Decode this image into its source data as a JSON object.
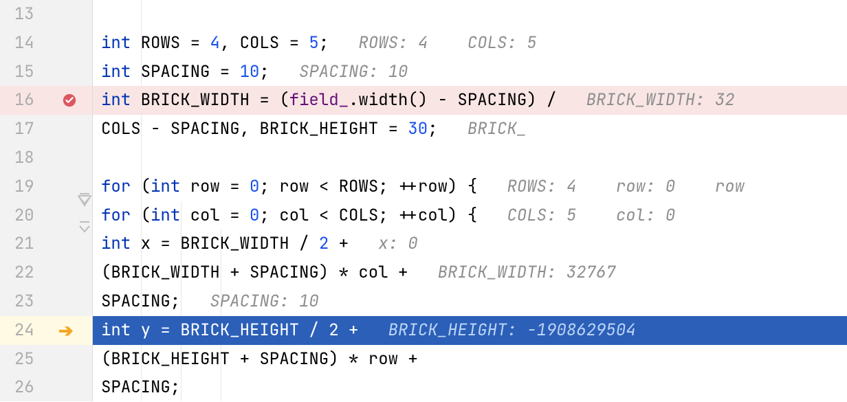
{
  "lines": {
    "l13": "13",
    "l14": "14",
    "l15": "15",
    "l16": "16",
    "l17": "17",
    "l18": "18",
    "l19": "19",
    "l20": "20",
    "l21": "21",
    "l22": "22",
    "l23": "23",
    "l24": "24",
    "l25": "25",
    "l26": "26"
  },
  "code": {
    "kw_int": "int",
    "kw_for": "for",
    "l14_a": " ROWS = ",
    "l14_n1": "4",
    "l14_b": ", COLS = ",
    "l14_n2": "5",
    "l14_c": ";",
    "l14_in": "   ROWS: 4    COLS: 5",
    "l15_a": " SPACING = ",
    "l15_n1": "10",
    "l15_b": ";",
    "l15_in": "   SPACING: 10",
    "l16_a": " BRICK_WIDTH = (",
    "l16_f": "field_",
    "l16_b": ".width() - SPACING) /",
    "l16_in": "   BRICK_WIDTH: 32",
    "l17_a": "COLS - SPACING, BRICK_HEIGHT = ",
    "l17_n1": "30",
    "l17_b": ";",
    "l17_in": "   BRICK_",
    "l19_a": " (",
    "l19_b": " row = ",
    "l19_n1": "0",
    "l19_c": "; row < ROWS; ++row) {",
    "l19_in": "   ROWS: 4    row: 0    row",
    "l20_a": " (",
    "l20_b": " col = ",
    "l20_n1": "0",
    "l20_c": "; col < COLS; ++col) {",
    "l20_in": "   COLS: 5    col: 0",
    "l21_a": " x = BRICK_WIDTH / ",
    "l21_n1": "2",
    "l21_b": " +",
    "l21_in": "   x: 0",
    "l22_a": "(BRICK_WIDTH + SPACING) * col +",
    "l22_in": "   BRICK_WIDTH: 32767",
    "l23_a": "SPACING;",
    "l23_in": "   SPACING: 10",
    "l24_a": " y = BRICK_HEIGHT / ",
    "l24_n1": "2",
    "l24_b": " +",
    "l24_in": "   BRICK_HEIGHT: -1908629504",
    "l25_a": "(BRICK_HEIGHT + SPACING) * row +",
    "l26_a": "SPACING;"
  }
}
